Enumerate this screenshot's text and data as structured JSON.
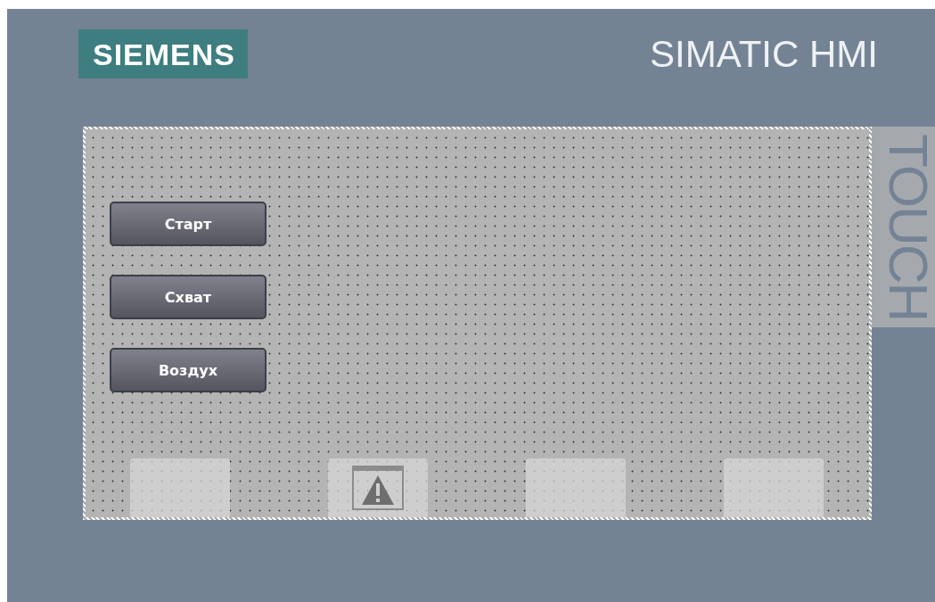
{
  "logo": {
    "text": "SIEMENS"
  },
  "title": "SIMATIC HMI",
  "side_label": "TOUCH",
  "buttons": [
    {
      "label": "Старт"
    },
    {
      "label": "Схват"
    },
    {
      "label": "Воздух"
    }
  ],
  "function_keys": [
    {
      "kind": "blank"
    },
    {
      "kind": "alarm"
    },
    {
      "kind": "blank"
    },
    {
      "kind": "blank"
    }
  ]
}
